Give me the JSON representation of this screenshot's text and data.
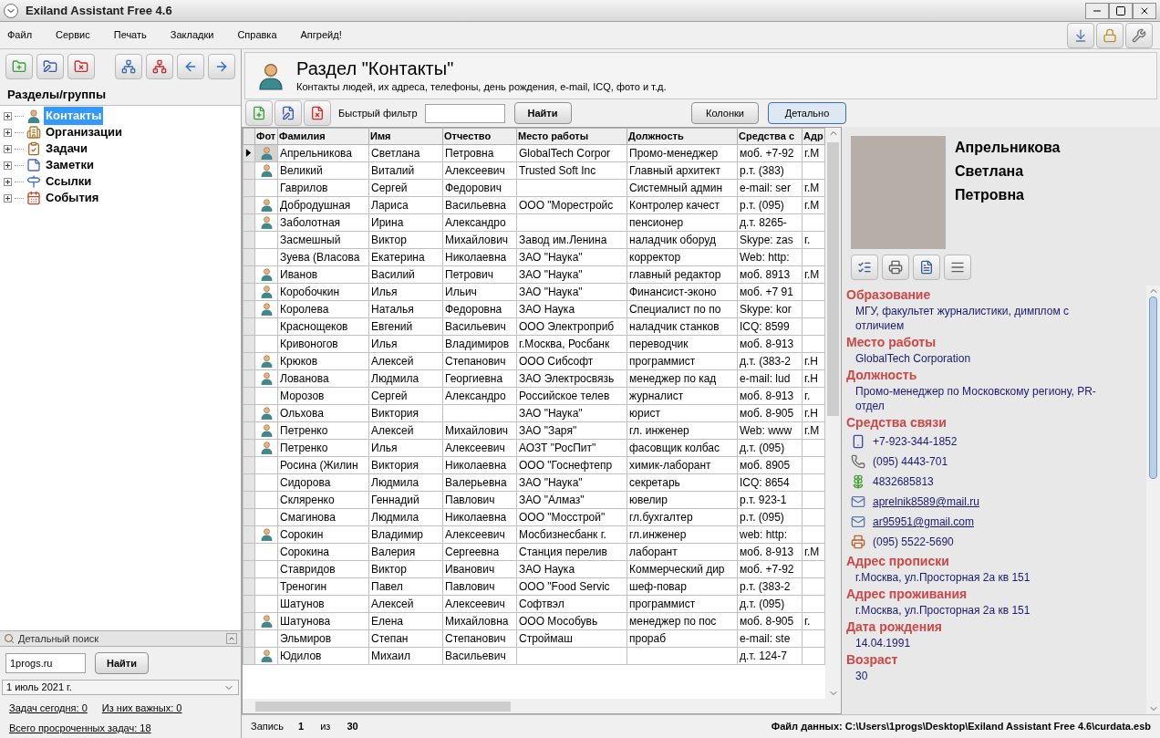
{
  "window": {
    "title": "Exiland Assistant Free 4.6"
  },
  "menu": [
    "Файл",
    "Сервис",
    "Печать",
    "Закладки",
    "Справка",
    "Апгрейд!"
  ],
  "sidebar": {
    "heading": "Разделы/группы",
    "items": [
      {
        "label": "Контакты",
        "kind": "contacts",
        "selected": true,
        "expanded": false
      },
      {
        "label": "Организации",
        "kind": "organizations",
        "selected": false,
        "expanded": false
      },
      {
        "label": "Задачи",
        "kind": "tasks",
        "selected": false,
        "expanded": false
      },
      {
        "label": "Заметки",
        "kind": "notes",
        "selected": false,
        "expanded": false
      },
      {
        "label": "Ссылки",
        "kind": "links",
        "selected": false,
        "expanded": false
      },
      {
        "label": "События",
        "kind": "events",
        "selected": false,
        "expanded": false
      }
    ],
    "search": {
      "title": "Детальный поиск",
      "value": "1progs.ru",
      "button": "Найти"
    },
    "date": "1 июль 2021 г.",
    "links": [
      "Задач сегодня: 0",
      "Из них важных: 0",
      "Всего просроченных задач: 18"
    ]
  },
  "section": {
    "title": "Раздел \"Контакты\"",
    "subtitle": "Контакты людей, их адреса, телефоны, день рождения, e-mail, ICQ, фото и т.д."
  },
  "toolbar": {
    "filter_label": "Быстрый фильтр",
    "find": "Найти",
    "buttons": [
      {
        "label": "Колонки",
        "selected": false
      },
      {
        "label": "Детально",
        "selected": true
      }
    ]
  },
  "table": {
    "photo_column": "Фот",
    "columns": [
      "Фамилия",
      "Имя",
      "Отчество",
      "Место работы",
      "Должность",
      "Средства с",
      "Адр"
    ],
    "rows": [
      {
        "selected": true,
        "has_photo": true,
        "cells": [
          "Апрельникова",
          "Светлана",
          "Петровна",
          "GlobalTech Corpor",
          "Промо-менеджер",
          "моб. +7-92",
          "г.М"
        ]
      },
      {
        "selected": false,
        "has_photo": true,
        "cells": [
          "Великий",
          "Виталий",
          "Алексеевич",
          "Trusted Soft Inc",
          "Главный архитект",
          "р.т. (383)",
          ""
        ]
      },
      {
        "selected": false,
        "has_photo": false,
        "cells": [
          "Гаврилов",
          "Сергей",
          "Федорович",
          "",
          "Системный админ",
          "e-mail: ser",
          "г.М"
        ]
      },
      {
        "selected": false,
        "has_photo": true,
        "cells": [
          "Добродушная",
          "Лариса",
          "Васильевна",
          "ООО \"Морестройс",
          "Контролер качест",
          "р.т. (095)",
          "г.М"
        ]
      },
      {
        "selected": false,
        "has_photo": true,
        "cells": [
          "Заболотная",
          "Ирина",
          "Александро",
          "",
          "пенсионер",
          "д.т. 8265-",
          ""
        ]
      },
      {
        "selected": false,
        "has_photo": false,
        "cells": [
          "Засмешный",
          "Виктор",
          "Михайлович",
          "Завод им.Ленина",
          "наладчик оборуд",
          "Skype: zas",
          "г."
        ]
      },
      {
        "selected": false,
        "has_photo": false,
        "cells": [
          "Зуева (Власова",
          "Екатерина",
          "Николаевна",
          "ЗАО \"Наука\"",
          "корректор",
          "Web: http:",
          ""
        ]
      },
      {
        "selected": false,
        "has_photo": true,
        "cells": [
          "Иванов",
          "Василий",
          "Петрович",
          "ЗАО \"Наука\"",
          "главный редактор",
          "моб. 8913",
          "г.М"
        ]
      },
      {
        "selected": false,
        "has_photo": true,
        "cells": [
          "Коробочкин",
          "Илья",
          "Ильич",
          "ЗАО \"Наука\"",
          "Финансист-эконо",
          "моб. +7 91",
          ""
        ]
      },
      {
        "selected": false,
        "has_photo": true,
        "cells": [
          "Королева",
          "Наталья",
          "Федоровна",
          "ЗАО Наука",
          "Специалист по по",
          "Skype: kor",
          ""
        ]
      },
      {
        "selected": false,
        "has_photo": false,
        "cells": [
          "Краснощеков",
          "Евгений",
          "Васильевич",
          "ООО Электроприб",
          "наладчик станков",
          "ICQ: 8599",
          ""
        ]
      },
      {
        "selected": false,
        "has_photo": false,
        "cells": [
          "Кривоногов",
          "Илья",
          "Владимиров",
          "г.Москва, Росбанк",
          "переводчик",
          "моб. 8-913",
          ""
        ]
      },
      {
        "selected": false,
        "has_photo": true,
        "cells": [
          "Крюков",
          "Алексей",
          "Степанович",
          "ООО Сибсофт",
          "программист",
          "д.т. (383-2",
          "г.Н"
        ]
      },
      {
        "selected": false,
        "has_photo": true,
        "cells": [
          "Лованова",
          "Людмила",
          "Георгиевна",
          "ЗАО Электросвязь",
          "менеджер по кад",
          "e-mail: lud",
          "г.Н"
        ]
      },
      {
        "selected": false,
        "has_photo": false,
        "cells": [
          "Морозов",
          "Сергей",
          "Александро",
          "Российское телев",
          "журналист",
          "моб. 8-913",
          "г."
        ]
      },
      {
        "selected": false,
        "has_photo": true,
        "cells": [
          "Ольхова",
          "Виктория",
          "",
          "ЗАО \"Наука\"",
          "юрист",
          "моб. 8-905",
          "г.Н"
        ]
      },
      {
        "selected": false,
        "has_photo": true,
        "cells": [
          "Петренко",
          "Алексей",
          "Михайлович",
          "ЗАО \"Заря\"",
          "гл. инженер",
          "Web: www",
          "г.М"
        ]
      },
      {
        "selected": false,
        "has_photo": true,
        "cells": [
          "Петренко",
          "Илья",
          "Алексеевич",
          "АОЗТ \"РосПит\"",
          "фасовщик колбас",
          "д.т. (095)",
          ""
        ]
      },
      {
        "selected": false,
        "has_photo": false,
        "cells": [
          "Росина (Жилин",
          "Виктория",
          "Николаевна",
          "ООО \"Госнефтепр",
          "химик-лаборант",
          "моб. 8905",
          ""
        ]
      },
      {
        "selected": false,
        "has_photo": false,
        "cells": [
          "Сидорова",
          "Людмила",
          "Валерьевна",
          "ЗАО \"Наука\"",
          "секретарь",
          "ICQ: 8654",
          ""
        ]
      },
      {
        "selected": false,
        "has_photo": false,
        "cells": [
          "Скляренко",
          "Геннадий",
          "Павлович",
          "ЗАО \"Алмаз\"",
          "ювелир",
          "р.т. 923-1",
          ""
        ]
      },
      {
        "selected": false,
        "has_photo": false,
        "cells": [
          "Смагинова",
          "Людмила",
          "Николаевна",
          "ООО \"Мосстрой\"",
          "гл.бухгалтер",
          "р.т. (095)",
          ""
        ]
      },
      {
        "selected": false,
        "has_photo": true,
        "cells": [
          "Сорокин",
          "Владимир",
          "Алексеевич",
          "Мосбизнесбанк г.",
          "гл.инженер",
          "web: http:",
          ""
        ]
      },
      {
        "selected": false,
        "has_photo": false,
        "cells": [
          "Сорокина",
          "Валерия",
          "Сергеевна",
          "Станция перелив",
          "лаборант",
          "моб. 8-913",
          "г.М"
        ]
      },
      {
        "selected": false,
        "has_photo": false,
        "cells": [
          "Ставридов",
          "Виктор",
          "Иванович",
          "ЗАО Наука",
          "Коммерческий дир",
          "моб. +7-92",
          ""
        ]
      },
      {
        "selected": false,
        "has_photo": false,
        "cells": [
          "Треногин",
          "Павел",
          "Павлович",
          "ООО \"Food Servic",
          "шеф-повар",
          "р.т. (383-2",
          ""
        ]
      },
      {
        "selected": false,
        "has_photo": false,
        "cells": [
          "Шатунов",
          "Алексей",
          "Алексеевич",
          "Софтвэл",
          "программист",
          "д.т. (095)",
          ""
        ]
      },
      {
        "selected": false,
        "has_photo": true,
        "cells": [
          "Шатунова",
          "Елена",
          "Михайловна",
          "ООО Мособувь",
          "менеджер по пос",
          "моб. 8-905",
          "г."
        ]
      },
      {
        "selected": false,
        "has_photo": false,
        "cells": [
          "Эльмиров",
          "Степан",
          "Степанович",
          "Строймаш",
          "прораб",
          "e-mail: ste",
          ""
        ]
      },
      {
        "selected": false,
        "has_photo": true,
        "cells": [
          "Юдилов",
          "Михаил",
          "Васильевич",
          "",
          "",
          "д.т. 124-7",
          ""
        ]
      }
    ]
  },
  "status_bar": {
    "record_label": "Запись",
    "record": "1",
    "of_label": "из",
    "total": "30",
    "file": "Файл данных: C:\\Users\\1progs\\Desktop\\Exiland Assistant Free 4.6\\curdata.esb"
  },
  "detail": {
    "name_lines": [
      "Апрельникова",
      "Светлана",
      "Петровна"
    ],
    "sections": [
      {
        "heading": "Образование",
        "kind": "text",
        "value": "МГУ, факультет журналистики, димплом с отличием"
      },
      {
        "heading": "Место работы",
        "kind": "text",
        "value": "GlobalTech Corporation"
      },
      {
        "heading": "Должность",
        "kind": "text",
        "value": "Промо-менеджер по Московскому региону, PR-отдел"
      },
      {
        "heading": "Средства связи",
        "kind": "contacts",
        "items": [
          {
            "kind": "mobile",
            "value": "+7-923-344-1852"
          },
          {
            "kind": "phone",
            "value": "(095) 4443-701"
          },
          {
            "kind": "icq",
            "value": "4832685813"
          },
          {
            "kind": "email",
            "value": "aprelnik8589@mail.ru"
          },
          {
            "kind": "email",
            "value": "ar95951@gmail.com"
          },
          {
            "kind": "fax",
            "value": "(095) 5522-5690"
          }
        ]
      },
      {
        "heading": "Адрес прописки",
        "kind": "text",
        "value": "г.Москва, ул.Просторная 2а кв 151"
      },
      {
        "heading": "Адрес проживания",
        "kind": "text",
        "value": "г.Москва, ул.Просторная 2а кв 151"
      },
      {
        "heading": "Дата рождения",
        "kind": "text",
        "value": "14.04.1991"
      },
      {
        "heading": "Возраст",
        "kind": "text",
        "value": "30"
      }
    ]
  }
}
